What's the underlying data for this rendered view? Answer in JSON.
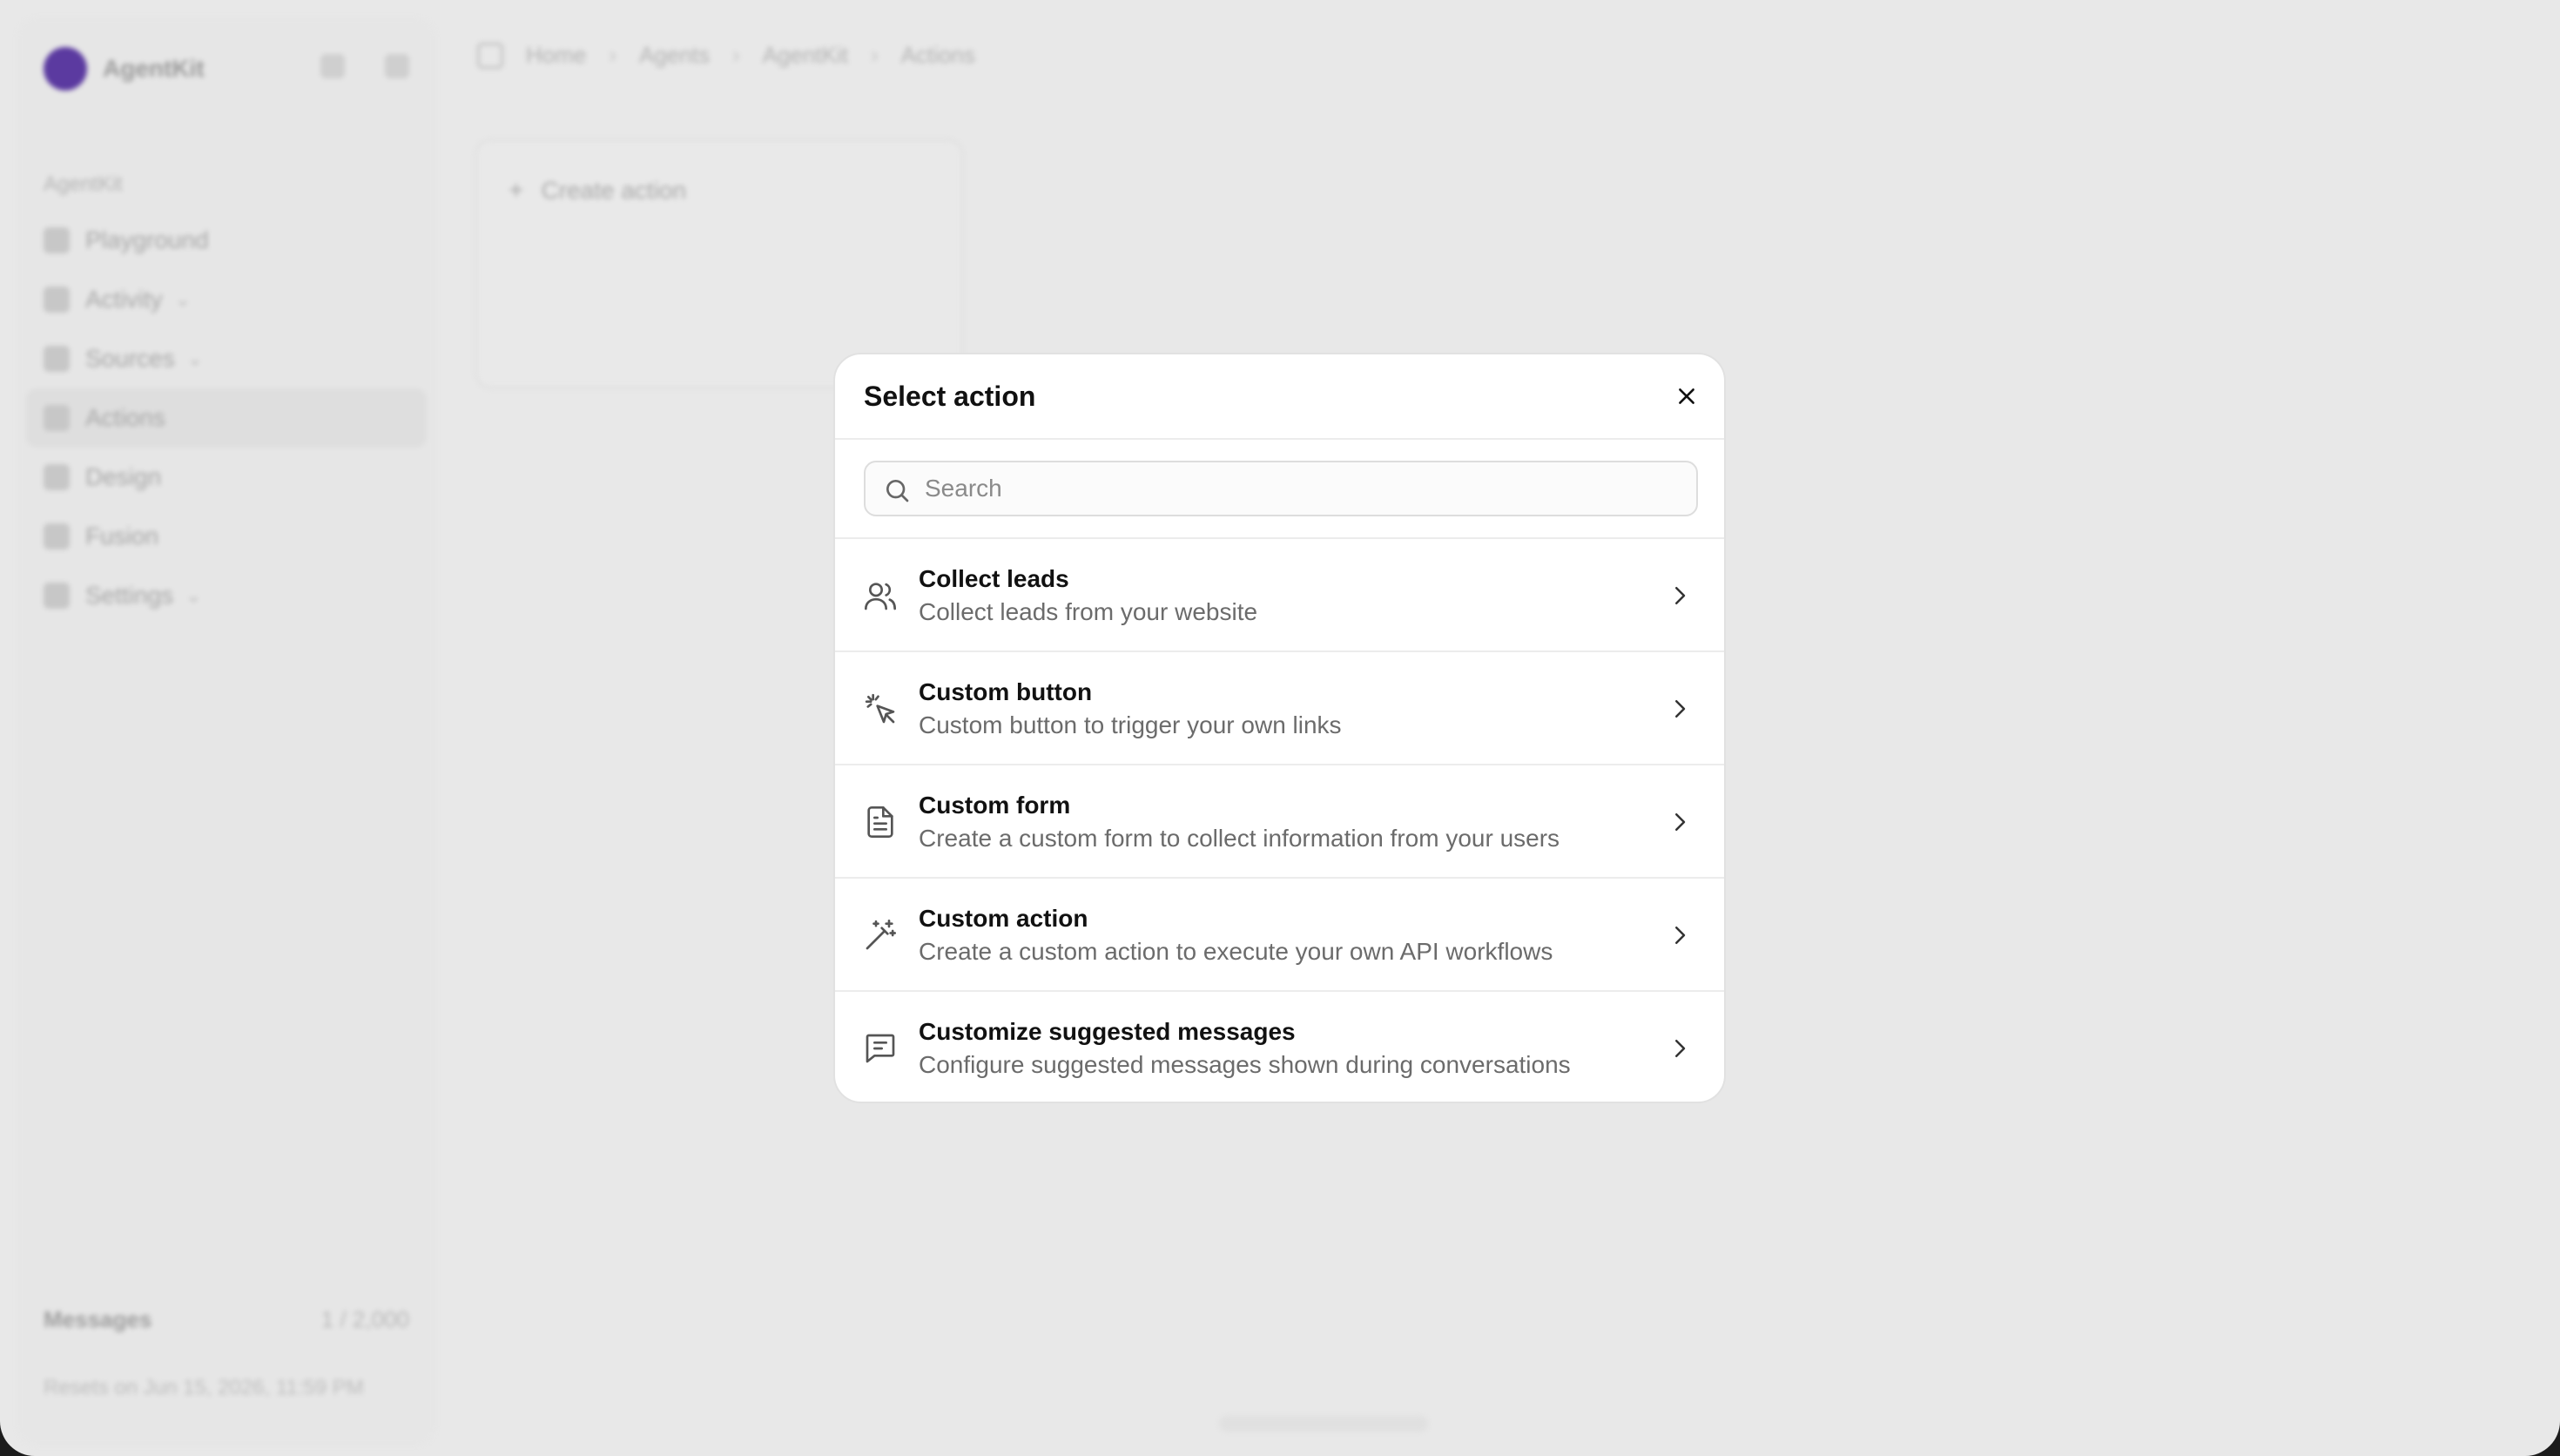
{
  "sidebar": {
    "brand_name": "AgentKit",
    "section_label": "AgentKit",
    "items": [
      {
        "label": "Playground",
        "icon": "playground-icon",
        "has_chevron": false,
        "active": false
      },
      {
        "label": "Activity",
        "icon": "activity-icon",
        "has_chevron": true,
        "active": false
      },
      {
        "label": "Sources",
        "icon": "sources-icon",
        "has_chevron": true,
        "active": false
      },
      {
        "label": "Actions",
        "icon": "actions-icon",
        "has_chevron": false,
        "active": true
      },
      {
        "label": "Design",
        "icon": "design-icon",
        "has_chevron": false,
        "active": false
      },
      {
        "label": "Fusion",
        "icon": "fusion-icon",
        "has_chevron": false,
        "active": false
      },
      {
        "label": "Settings",
        "icon": "settings-icon",
        "has_chevron": true,
        "active": false
      }
    ],
    "usage_label": "Messages",
    "usage_count": "1 / 2,000",
    "reset_note": "Resets on Jun 15, 2026, 11:59 PM"
  },
  "breadcrumb": [
    "Home",
    "Agents",
    "AgentKit",
    "Actions"
  ],
  "main": {
    "create_action_label": "Create action"
  },
  "modal": {
    "title": "Select action",
    "search_placeholder": "Search",
    "actions": [
      {
        "title": "Collect leads",
        "description": "Collect leads from your website",
        "icon": "users-icon"
      },
      {
        "title": "Custom button",
        "description": "Custom button to trigger your own links",
        "icon": "pointer-click-icon"
      },
      {
        "title": "Custom form",
        "description": "Create a custom form to collect information from your users",
        "icon": "document-icon"
      },
      {
        "title": "Custom action",
        "description": "Create a custom action to execute your own API workflows",
        "icon": "magic-wand-icon"
      },
      {
        "title": "Customize suggested messages",
        "description": "Configure suggested messages shown during conversations",
        "icon": "message-square-icon"
      }
    ]
  },
  "colors": {
    "overlay_bg": "#e8e8e8",
    "brand_avatar": "#5b3aa0",
    "modal_bg": "#ffffff",
    "text_primary": "#111111",
    "text_secondary": "#6b6b6b"
  }
}
